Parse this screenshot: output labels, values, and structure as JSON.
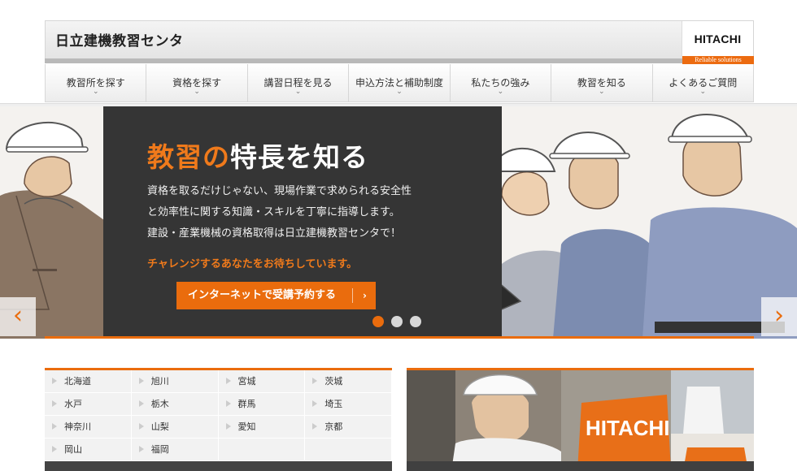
{
  "header": {
    "site_title": "日立建機教習センタ",
    "brand_name": "HITACHI",
    "brand_tagline": "Reliable solutions"
  },
  "nav": {
    "items": [
      {
        "label": "教習所を探す"
      },
      {
        "label": "資格を探す"
      },
      {
        "label": "講習日程を見る"
      },
      {
        "label": "申込方法と補助制度"
      },
      {
        "label": "私たちの強み"
      },
      {
        "label": "教習を知る"
      },
      {
        "label": "よくあるご質問"
      }
    ],
    "chevron": "⌄"
  },
  "hero": {
    "title_accent": "教習の",
    "title_rest": "特長を知る",
    "body_lines": [
      "資格を取るだけじゃない、現場作業で求められる安全性",
      "と効率性に関する知識・スキルを丁寧に指導します。",
      "建設・産業機械の資格取得は日立建機教習センタで！"
    ],
    "cta_text": "チャレンジするあなたをお待ちしています。",
    "button_label": "インターネットで受講予約する",
    "button_arrow": "›",
    "slides": 3,
    "active_slide": 1,
    "prev": "‹",
    "next": "›"
  },
  "locations": [
    "北海道",
    "旭川",
    "宮城",
    "茨城",
    "水戸",
    "栃木",
    "群馬",
    "埼玉",
    "神奈川",
    "山梨",
    "愛知",
    "京都",
    "岡山",
    "福岡"
  ],
  "photo": {
    "machine_text": "HITACHI"
  },
  "colors": {
    "accent": "#ea6c0d",
    "panel": "#353535"
  }
}
